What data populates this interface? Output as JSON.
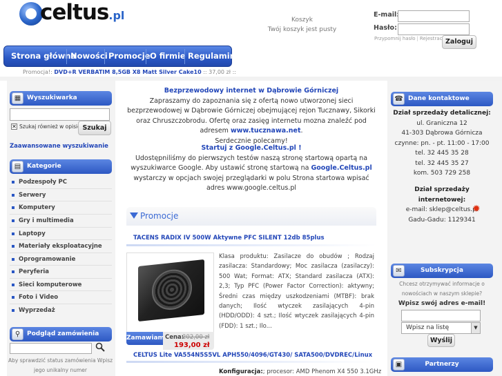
{
  "header": {
    "logo_brand": "celtus",
    "logo_tld": ".pl",
    "cart_title": "Koszyk",
    "cart_status": "Twój koszyk jest pusty",
    "email_label": "E-mail:",
    "password_label": "Hasło:",
    "remind_password": "Przypomnij hasło",
    "register": "Rejestracja",
    "login_button": "Zaloguj"
  },
  "nav": {
    "items": [
      "Strona główna",
      "Nowości",
      "Promocje",
      "O firmie",
      "Regulamin"
    ]
  },
  "promo_bar": {
    "label": "Promocja!:",
    "product": "DVD+R VERBATIM 8,5GB X8 Matt Silver Cake10",
    "price": ":: 37,00 zł ::"
  },
  "left": {
    "search_title": "Wyszukiwarka",
    "search_desc_label": "Szukaj również w opisie",
    "search_button": "Szukaj",
    "advanced_search": "Zaawansowane wyszukiwanie",
    "categories_title": "Kategorie",
    "categories": [
      "Podzespoły PC",
      "Serwery",
      "Komputery",
      "Gry i multimedia",
      "Laptopy",
      "Materiały eksploatacyjne",
      "Oprogramowanie",
      "Peryferia",
      "Sieci komputerowe",
      "Foto i Video",
      "Wyprzedaż"
    ],
    "order_title": "Podgląd zamówienia",
    "order_help": "Aby sprawdzić status zamówienia Wpisz jego unikalny numer"
  },
  "center": {
    "internet_title": "Bezprzewodowy internet w Dąbrowie Górniczej",
    "internet_text": "Zapraszamy do zapoznania się z ofertą nowo utworzonej sieci bezprzewodowej w Dąbrowie Górniczej obejmującej rejon Tucznawy, Sikorki oraz Chruszczobrodu. Ofertę oraz zasięg internetu mozna znaleźć pod adresem",
    "internet_link": "www.tucznawa.net",
    "internet_dot": ".",
    "internet_greet": "Serdecznie polecamy!",
    "google_title": "Startuj z Google.Celtus.pl !",
    "google_text1": "Udostępniliśmy do pierwszych testów naszą stronę startową opartą na wyszukiwarce Google. Aby ustawić stronę startową na",
    "google_link": "Google.Celtus.pl",
    "google_text2": "wystarczy w opcjach swojej przeglądarki w polu Strona startowa wpisać adres www.google.celtus.pl",
    "promocje_title": "Promocje",
    "products": [
      {
        "name": "TACENS RADIX IV 500W Aktywne PFC SILENT 12db 85plus",
        "description": "Klasa produktu: Zasilacze do obudów ; Rodzaj zasilacza: Standardowy; Moc zasilacza (zasilaczy): 500 Wat; Format: ATX; Standard zasilacza (ATX): 2,3; Typ PFC (Power Factor Correction): aktywny; Średni czas między uszkodzeniami (MTBF): brak danych; Ilość wtyczek zasilających 4-pin (HDD/ODD): 4 szt.; Ilość wtyczek zasilających 4-pin (FDD): 1 szt.; Ilo...",
        "order_button": "Zamawiam",
        "price_label": "Cena:",
        "old_price": "202,00 zł",
        "new_price": "193,00 zł"
      },
      {
        "name": "CELTUS Lite VA554N5S5VL APH550/4096/GT430/ SATA500/DVDREC/Linux",
        "config_label": "Konfiguracja:",
        "config_text": "; procesor: AMD Phenom X4 550 3.1GHz"
      }
    ]
  },
  "right": {
    "contact_title": "Dane kontaktowe",
    "retail_title": "Dział sprzedaży detalicznej:",
    "retail_lines": [
      "ul. Graniczna 12",
      "41-303 Dąbrowa Górnicza",
      "czynne: pn. - pt. 11:00 - 17:00",
      "tel. 32 445 35 28",
      "tel. 32 445 35 27",
      "kom. 503 729 258"
    ],
    "internet_sales_title": "Dział sprzedaży internetowej:",
    "email_line": "e-mail: sklep@celtus.pl",
    "gg_line": "Gadu-Gadu: 1129341",
    "subscription_title": "Subskrypcja",
    "subscription_text": "Chcesz otrzymywać informacje o nowościach w naszym sklepie?",
    "subscription_prompt": "Wpisz swój adres e-mail!",
    "select_value": "Wpisz na listę",
    "send_button": "Wyślij",
    "partners_title": "Partnerzy"
  },
  "colors": {
    "accent_blue": "#2a57c4",
    "link_blue": "#2246b8",
    "price_red": "#cc0000"
  }
}
